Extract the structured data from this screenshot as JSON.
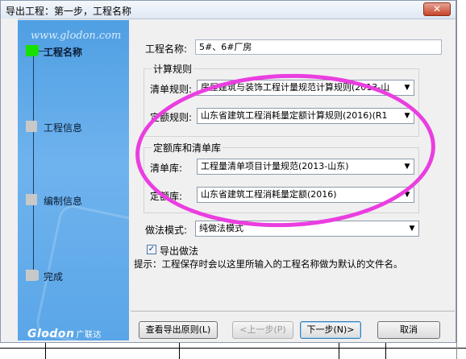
{
  "window": {
    "title": "导出工程：第一步，工程名称",
    "close_label": "✕"
  },
  "sidebar": {
    "url": "www.glodon.com",
    "steps": [
      {
        "label": "工程名称",
        "active": true
      },
      {
        "label": "工程信息",
        "active": false
      },
      {
        "label": "编制信息",
        "active": false
      },
      {
        "label": "完成",
        "active": false
      }
    ],
    "logo": "Glodon",
    "logo_cn": "广联达"
  },
  "form": {
    "project_name_label": "工程名称:",
    "project_name_value": "5#、6#厂房",
    "calc_rules_group": "计算规则",
    "bill_rule_label": "清单规则:",
    "bill_rule_value": "房屋建筑与装饰工程计量规范计算规则(2013-山",
    "quota_rule_label": "定额规则:",
    "quota_rule_value": "山东省建筑工程消耗量定额计算规则(2016)(R1",
    "libs_group": "定额库和清单库",
    "bill_lib_label": "清单库:",
    "bill_lib_value": "工程量清单项目计量规范(2013-山东)",
    "quota_lib_label": "定额库:",
    "quota_lib_value": "山东省建筑工程消耗量定额(2016)",
    "method_mode_label": "做法模式:",
    "method_mode_value": "纯做法模式",
    "export_method_label": "导出做法",
    "export_method_checked": true,
    "hint": "提示：工程保存时会以这里所输入的工程名称做为默认的文件名。"
  },
  "buttons": {
    "export_rules": "查看导出原则(L)",
    "prev": "<上一步(P)",
    "next": "下一步(N)>",
    "cancel": "取消"
  },
  "annotation_color": "#ea3ee0"
}
